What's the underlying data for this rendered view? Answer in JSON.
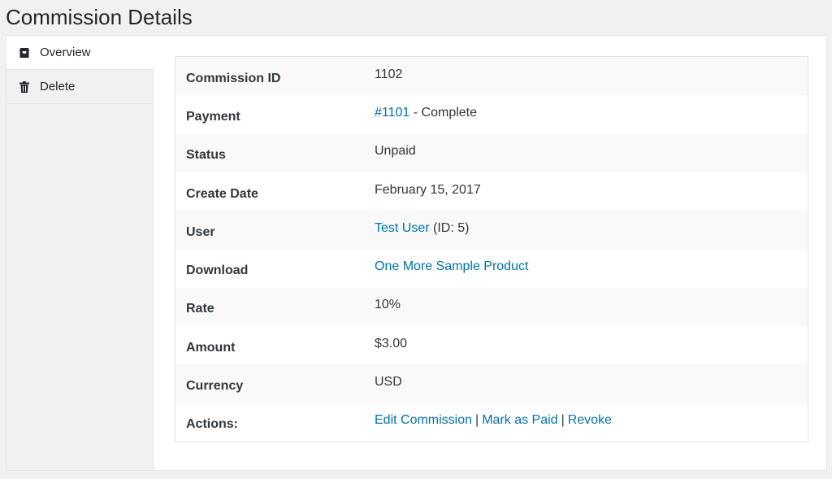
{
  "page_title": "Commission Details",
  "sidebar": {
    "tabs": [
      {
        "label": "Overview",
        "icon": "store-icon"
      },
      {
        "label": "Delete",
        "icon": "trash-icon"
      }
    ]
  },
  "details": {
    "commission_id": {
      "label": "Commission ID",
      "value": "1102"
    },
    "payment": {
      "label": "Payment",
      "link": "#1101",
      "suffix": " - Complete"
    },
    "status": {
      "label": "Status",
      "value": "Unpaid"
    },
    "create_date": {
      "label": "Create Date",
      "value": "February 15, 2017"
    },
    "user": {
      "label": "User",
      "link": "Test User",
      "suffix": " (ID: 5)"
    },
    "download": {
      "label": "Download",
      "link": "One More Sample Product"
    },
    "rate": {
      "label": "Rate",
      "value": "10%"
    },
    "amount": {
      "label": "Amount",
      "value": "$3.00"
    },
    "currency": {
      "label": "Currency",
      "value": "USD"
    },
    "actions": {
      "label": "Actions:",
      "edit": "Edit Commission",
      "mark_paid": "Mark as Paid",
      "revoke": "Revoke",
      "separator": "|"
    }
  },
  "colors": {
    "link": "#0073aa",
    "text": "#32373c",
    "background": "#f1f1f1"
  }
}
